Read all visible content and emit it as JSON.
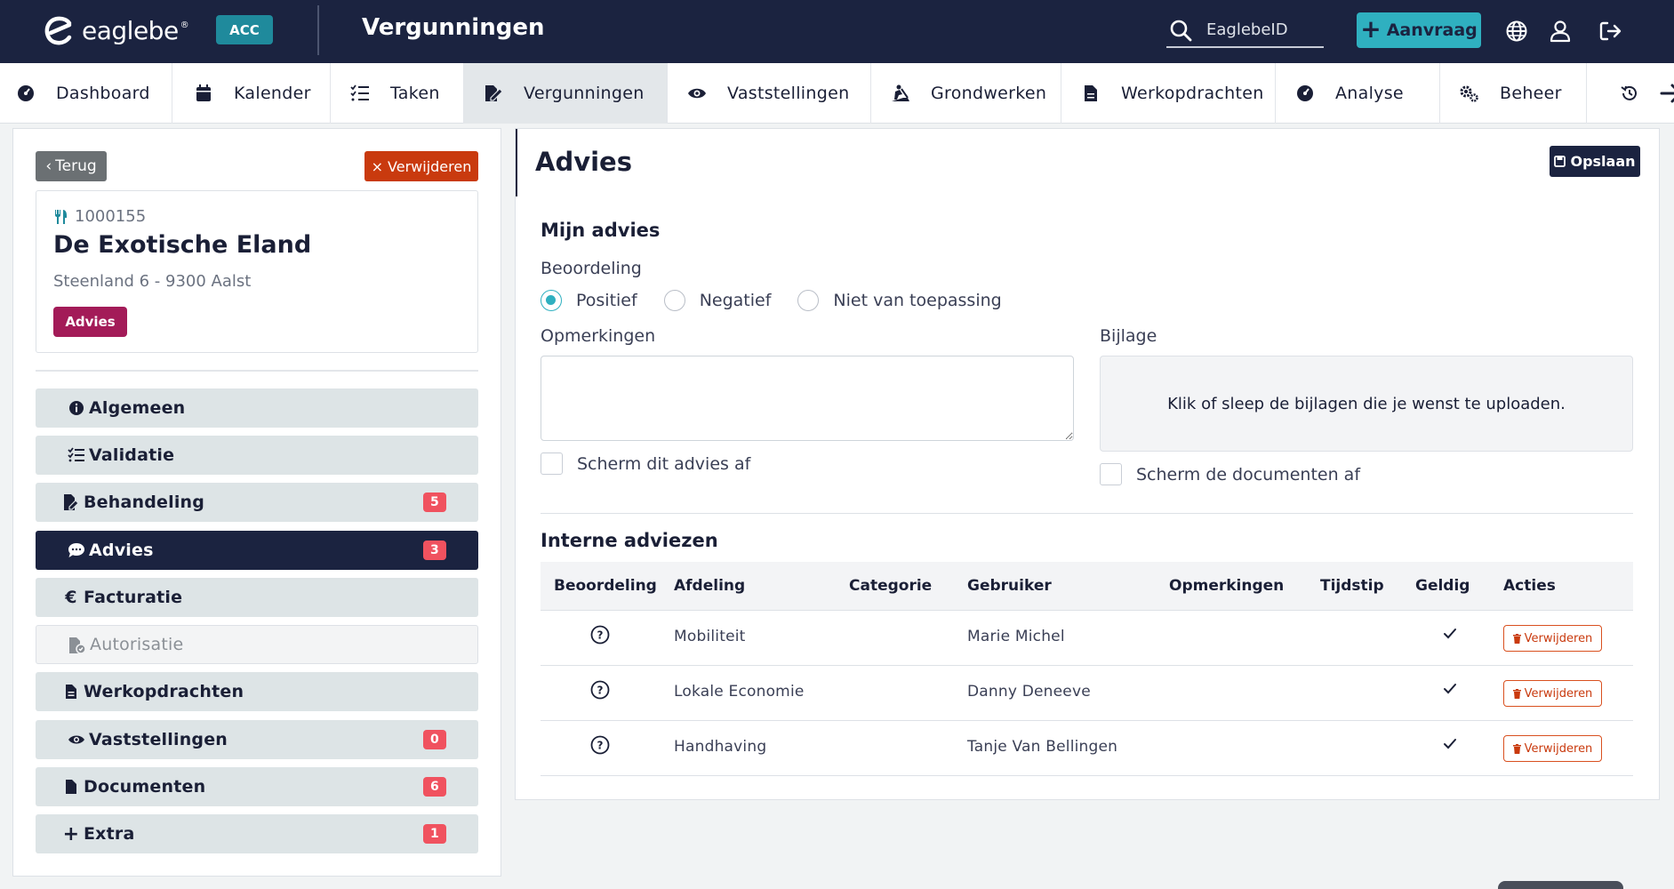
{
  "topbar": {
    "logo_text": "eaglebe",
    "env_badge": "ACC",
    "title": "Vergunningen",
    "search_placeholder": "EaglebeID",
    "new_button_label": "Aanvraag",
    "icons": [
      "globe-icon",
      "user-icon",
      "logout-icon"
    ]
  },
  "nav": {
    "items": [
      {
        "label": "Dashboard",
        "icon": "dashboard-icon"
      },
      {
        "label": "Kalender",
        "icon": "calendar-icon"
      },
      {
        "label": "Taken",
        "icon": "tasks-icon"
      },
      {
        "label": "Vergunningen",
        "icon": "permit-icon",
        "active": true
      },
      {
        "label": "Vaststellingen",
        "icon": "eye-icon"
      },
      {
        "label": "Grondwerken",
        "icon": "digging-icon"
      },
      {
        "label": "Werkopdrachten",
        "icon": "file-icon"
      },
      {
        "label": "Analyse",
        "icon": "analysis-icon"
      },
      {
        "label": "Beheer",
        "icon": "cogs-icon"
      }
    ]
  },
  "left": {
    "back_label": "Terug",
    "delete_label": "Verwijderen",
    "case": {
      "id": "1000155",
      "name": "De Exotische Eland",
      "address": "Steenland 6 - 9300 Aalst",
      "badge": "Advies"
    },
    "menu": [
      {
        "label": "Algemeen",
        "icon": "info-icon",
        "count": ""
      },
      {
        "label": "Validatie",
        "icon": "checklist-icon",
        "count": ""
      },
      {
        "label": "Behandeling",
        "icon": "file-edit-icon",
        "count": "5"
      },
      {
        "label": "Advies",
        "icon": "comment-icon",
        "count": "3",
        "active": true
      },
      {
        "label": "Facturatie",
        "icon": "euro-icon",
        "count": ""
      },
      {
        "label": "Autorisatie",
        "icon": "file-lock-icon",
        "count": "",
        "disabled": true
      },
      {
        "label": "Werkopdrachten",
        "icon": "file-icon",
        "count": ""
      },
      {
        "label": "Vaststellingen",
        "icon": "eye-icon",
        "count": "0"
      },
      {
        "label": "Documenten",
        "icon": "document-icon",
        "count": "6"
      },
      {
        "label": "Extra",
        "icon": "plus-icon",
        "count": "1"
      }
    ]
  },
  "main": {
    "title": "Advies",
    "save_label": "Opslaan",
    "my_advice": {
      "heading": "Mijn advies",
      "rating_label": "Beoordeling",
      "options": [
        "Positief",
        "Negatief",
        "Niet van toepassing"
      ],
      "selected": "Positief",
      "remarks_label": "Opmerkingen",
      "remarks_value": "",
      "shield_advice_label": "Scherm dit advies af",
      "attachment_label": "Bijlage",
      "dropzone_text": "Klik of sleep de bijlagen die je wenst te uploaden.",
      "shield_docs_label": "Scherm de documenten af"
    },
    "internal": {
      "heading": "Interne adviezen",
      "columns": [
        "Beoordeling",
        "Afdeling",
        "Categorie",
        "Gebruiker",
        "Opmerkingen",
        "Tijdstip",
        "Geldig",
        "Acties"
      ],
      "rows": [
        {
          "department": "Mobiliteit",
          "category": "",
          "user": "Marie Michel",
          "remarks": "",
          "time": "",
          "valid": true,
          "action": "Verwijderen"
        },
        {
          "department": "Lokale Economie",
          "category": "",
          "user": "Danny Deneeve",
          "remarks": "",
          "time": "",
          "valid": true,
          "action": "Verwijderen"
        },
        {
          "department": "Handhaving",
          "category": "",
          "user": "Tanje Van Bellingen",
          "remarks": "",
          "time": "",
          "valid": true,
          "action": "Verwijderen"
        }
      ]
    }
  },
  "colors": {
    "brand_dark": "#1b2340",
    "accent_teal": "#2fb0c0",
    "danger": "#c93a0e",
    "badge_magenta": "#a31b58",
    "count_red": "#f0525f"
  }
}
